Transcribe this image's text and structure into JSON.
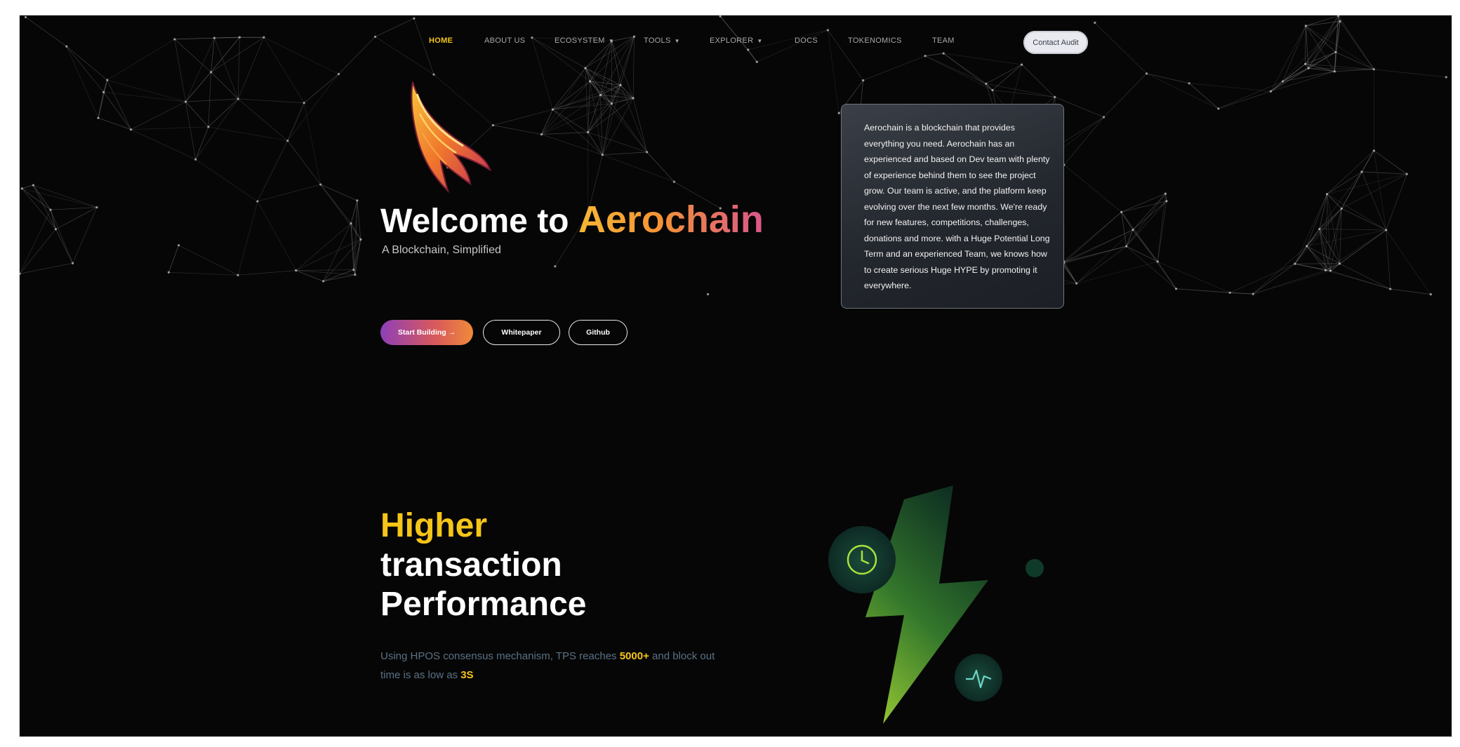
{
  "nav": {
    "items": [
      {
        "label": "HOME",
        "active": true,
        "dropdown": false
      },
      {
        "label": "ABOUT US",
        "active": false,
        "dropdown": false
      },
      {
        "label": "ECOSYSTEM",
        "active": false,
        "dropdown": true
      },
      {
        "label": "TOOLS",
        "active": false,
        "dropdown": true
      },
      {
        "label": "EXPLORER",
        "active": false,
        "dropdown": true
      },
      {
        "label": "DOCS",
        "active": false,
        "dropdown": false
      },
      {
        "label": "TOKENOMICS",
        "active": false,
        "dropdown": false
      },
      {
        "label": "TEAM",
        "active": false,
        "dropdown": false
      }
    ],
    "contact_label": "Contact Audit"
  },
  "hero": {
    "title_prefix": "Welcome to",
    "title_brand": "Aerochain",
    "subtitle": "A Blockchain, Simplified",
    "logo_icon": "winged-logo-icon",
    "buttons": {
      "start": "Start Building →",
      "whitepaper": "Whitepaper",
      "github": "Github"
    }
  },
  "info_card": {
    "text": "Aerochain is a blockchain that provides everything you need. Aerochain has an experienced and based on Dev team with plenty of experience behind them to see the project grow. Our team is active, and the platform keep evolving over the next few months. We're ready for new features, competitions, challenges, donations and more. with a Huge Potential Long Term and an experienced Team, we knows how to create serious Huge HYPE by promoting it everywhere."
  },
  "performance": {
    "title_line1": "Higher",
    "title_line2": "transaction",
    "title_line3": "Performance",
    "desc_part1": "Using HPOS consensus mechanism, TPS reaches ",
    "tps": "5000+",
    "desc_part2": " and block out time is as low as ",
    "block_time": "3S",
    "icons": [
      "clock-icon",
      "lightning-bolt-icon",
      "pulse-icon"
    ]
  },
  "colors": {
    "background": "#060606",
    "accent_yellow": "#f5c518",
    "brand_gradient_start": "#f7b733",
    "brand_gradient_end": "#d9568c",
    "bolt_green": "#8bd43a"
  }
}
